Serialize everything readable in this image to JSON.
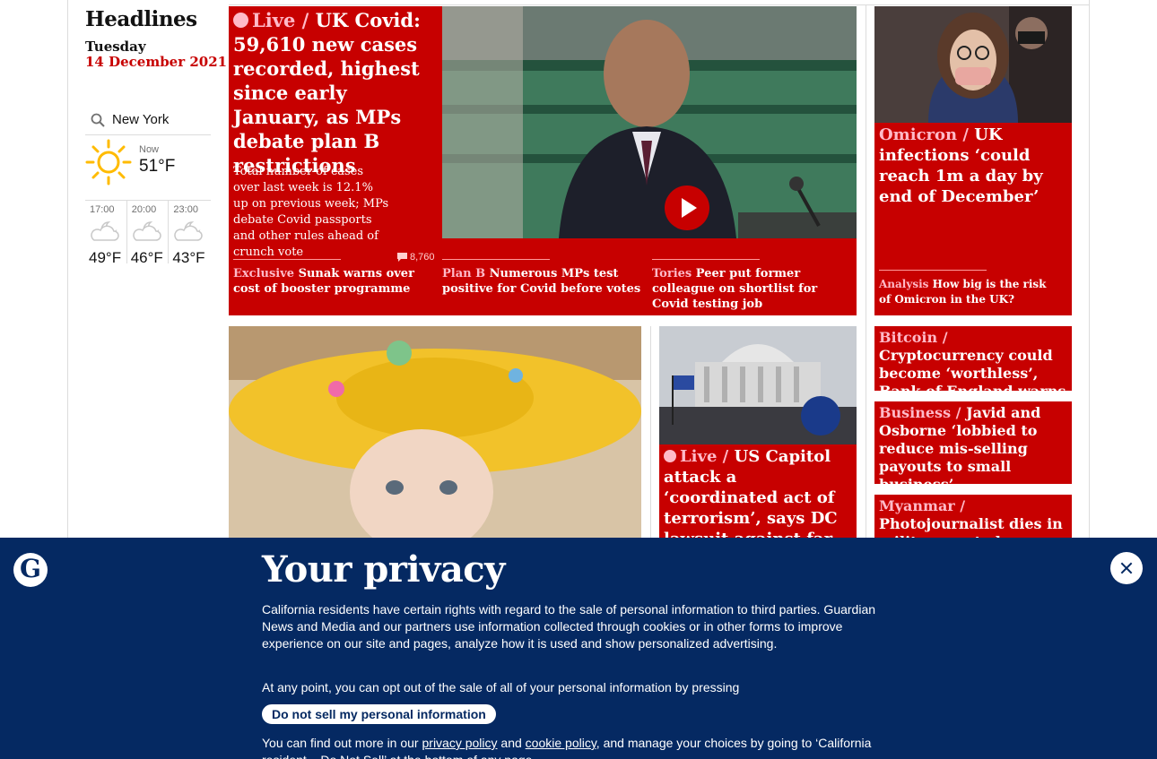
{
  "sidebar": {
    "title": "Headlines",
    "day": "Tuesday",
    "date": "14 December 2021"
  },
  "weather": {
    "location": "New York",
    "now_label": "Now",
    "now_temp": "51°F",
    "forecast": [
      {
        "time": "17:00",
        "temp": "49°F"
      },
      {
        "time": "20:00",
        "temp": "46°F"
      },
      {
        "time": "23:00",
        "temp": "43°F"
      }
    ]
  },
  "main_story": {
    "kicker": "Live",
    "headline": "UK Covid: 59,610 new cases recorded, highest since early January, as MPs debate plan B restrictions",
    "standfirst": "Total number of cases over last week is 12.1% up on previous week; MPs debate Covid passports and other rules ahead of crunch vote",
    "comments": "8,760",
    "sublinks": [
      {
        "kicker": "Exclusive",
        "text": "Sunak warns over cost of booster programme"
      },
      {
        "kicker": "Plan B",
        "text": "Numerous MPs test positive for Covid before votes"
      },
      {
        "kicker": "Tories",
        "text": "Peer put former colleague on shortlist for Covid testing job"
      }
    ]
  },
  "right_story": {
    "kicker": "Omicron",
    "headline": "UK infections ‘could reach 1m a day by end of December’",
    "analysis_kicker": "Analysis",
    "analysis_text": "How big is the risk of Omicron in the UK?"
  },
  "right_list": [
    {
      "kicker": "Bitcoin",
      "text": "Cryptocurrency could become ‘worthless’, Bank of England warns"
    },
    {
      "kicker": "Business",
      "text": "Javid and Osborne ‘lobbied to reduce mis-selling payouts to small business’"
    },
    {
      "kicker": "Myanmar",
      "text": "Photojournalist dies in military custody, say rel…"
    }
  ],
  "capitol_story": {
    "kicker": "Live",
    "headline": "US Capitol attack a ‘coordinated act of terrorism’, says DC lawsuit against far-right groups"
  },
  "privacy": {
    "logo_letter": "G",
    "title": "Your privacy",
    "p1": "California residents have certain rights with regard to the sale of personal information to third parties. Guardian News and Media and our partners use information collected through cookies or in other forms to improve experience on our site and pages, analyze how it is used and show personalized advertising.",
    "p2": "At any point, you can opt out of the sale of all of your personal information by pressing",
    "button": "Do not sell my personal information",
    "p3_start": "You can find out more in our",
    "privacy_link": "privacy policy",
    "p3_and": "and",
    "cookie_link": "cookie policy",
    "p3_end": ", and manage your choices by going to ‘California resident – Do Not Sell’ at the bottom of any page."
  },
  "colors": {
    "news_red": "#c70000",
    "live_pink": "#ffbac8",
    "brand_blue": "#052962"
  }
}
